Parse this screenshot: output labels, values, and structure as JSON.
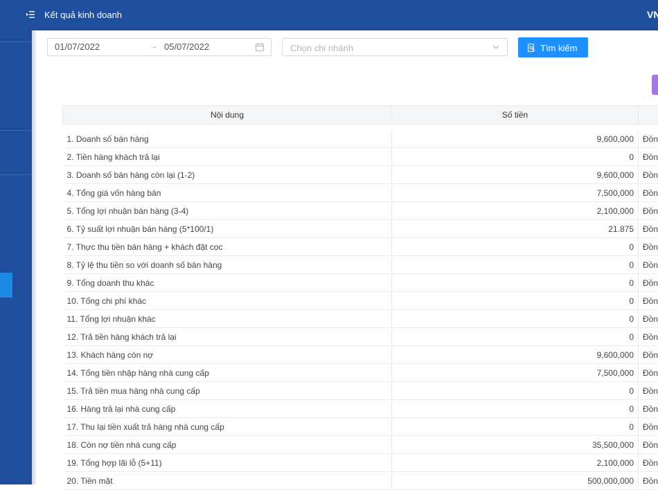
{
  "header": {
    "title": "Kết quả kinh doanh",
    "lang": "VN"
  },
  "filters": {
    "date_start": "01/07/2022",
    "date_separator": "→",
    "date_end": "05/07/2022",
    "branch_placeholder": "Chọn chi nhánh",
    "search_label": "Tìm kiếm"
  },
  "table": {
    "headers": [
      "Nội dung",
      "Số tiền",
      ""
    ],
    "rows": [
      {
        "content": "1. Doanh số bán hàng",
        "amount": "9,600,000",
        "unit": "Đồng"
      },
      {
        "content": "2. Tiền hàng khách trả lại",
        "amount": "0",
        "unit": "Đồng"
      },
      {
        "content": "3. Doanh số bán hàng còn lại (1-2)",
        "amount": "9,600,000",
        "unit": "Đồng"
      },
      {
        "content": "4. Tổng giá vốn hàng bán",
        "amount": "7,500,000",
        "unit": "Đồng"
      },
      {
        "content": "5. Tổng lợi nhuận bán hàng (3-4)",
        "amount": "2,100,000",
        "unit": "Đồng"
      },
      {
        "content": "6. Tỷ suất lợi nhuận bán hàng (5*100/1)",
        "amount": "21.875",
        "unit": "Đồng"
      },
      {
        "content": "7. Thực thu tiền bán hàng + khách đặt cọc",
        "amount": "0",
        "unit": "Đồng"
      },
      {
        "content": "8. Tỷ lệ thu tiền so với doanh số bán hàng",
        "amount": "0",
        "unit": "Đồng"
      },
      {
        "content": "9. Tổng doanh thu khác",
        "amount": "0",
        "unit": "Đồng"
      },
      {
        "content": "10. Tổng chi phí khác",
        "amount": "0",
        "unit": "Đồng"
      },
      {
        "content": "11. Tổng lợi nhuận khác",
        "amount": "0",
        "unit": "Đồng"
      },
      {
        "content": "12. Trả tiền hàng khách trả lại",
        "amount": "0",
        "unit": "Đồng"
      },
      {
        "content": "13. Khách hàng còn nợ",
        "amount": "9,600,000",
        "unit": "Đồng"
      },
      {
        "content": "14. Tổng tiền nhập hàng nhà cung cấp",
        "amount": "7,500,000",
        "unit": "Đồng"
      },
      {
        "content": "15. Trả tiền mua hàng nhà cung cấp",
        "amount": "0",
        "unit": "Đồng"
      },
      {
        "content": "16. Hàng trả lại nhà cung cấp",
        "amount": "0",
        "unit": "Đồng"
      },
      {
        "content": "17. Thu lại tiền xuất trả hàng nhà cung cấp",
        "amount": "0",
        "unit": "Đồng"
      },
      {
        "content": "18. Còn nợ tiền nhà cung cấp",
        "amount": "35,500,000",
        "unit": "Đồng"
      },
      {
        "content": "19. Tổng hợp lãi lỗ (5+11)",
        "amount": "2,100,000",
        "unit": "Đồng"
      },
      {
        "content": "20. Tiền mặt",
        "amount": "500,000,000",
        "unit": "Đồng"
      }
    ]
  },
  "icons": {
    "menu": "menu-fold-icon",
    "calendar": "calendar-icon",
    "chevron": "chevron-down-icon",
    "search": "file-search-icon"
  },
  "colors": {
    "primary_navy": "#1f4e9c",
    "accent_blue": "#1e90ff",
    "purple": "#a872e8",
    "logo_orange": "#f5a623"
  }
}
